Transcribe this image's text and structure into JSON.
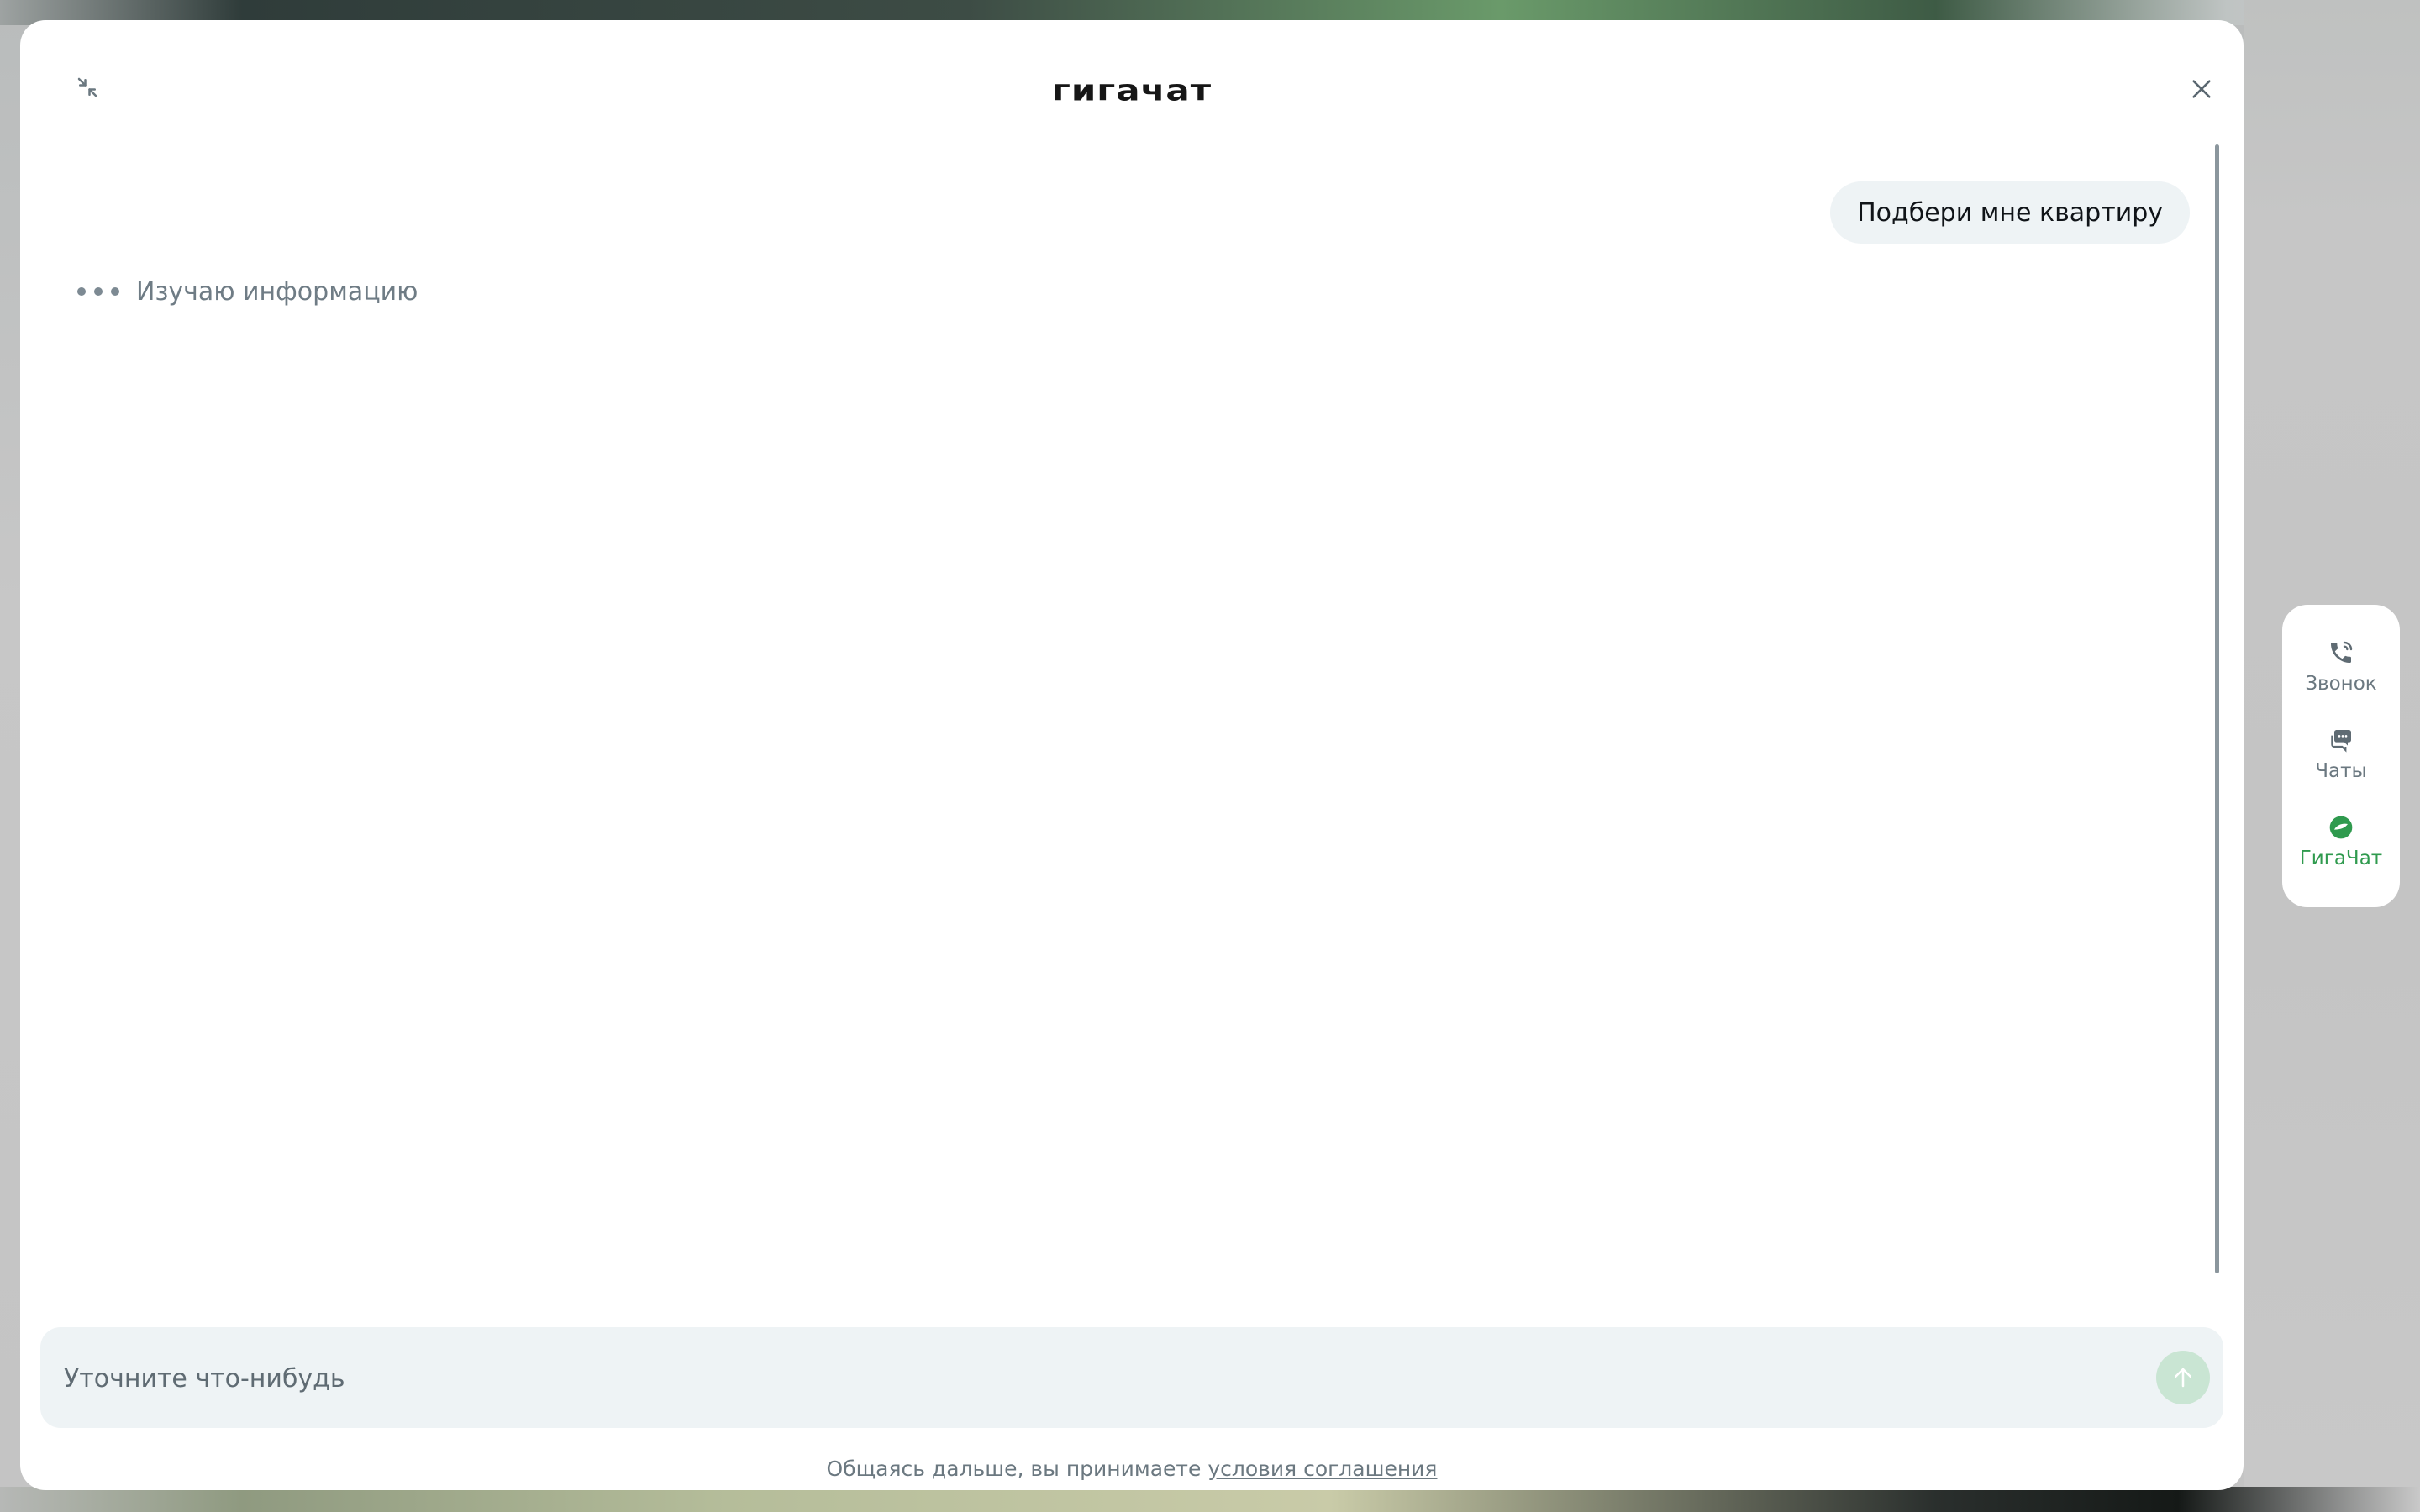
{
  "header": {
    "logo_text": "ГИГАЧАТ"
  },
  "chat": {
    "user_message": "Подбери мне квартиру",
    "status_text": "Изучаю информацию"
  },
  "composer": {
    "placeholder": "Уточните что-нибудь"
  },
  "footer": {
    "text": "Общаясь дальше, вы принимаете",
    "link_text": "условия соглашения"
  },
  "side_panel": {
    "items": [
      {
        "label": "Звонок",
        "icon": "phone-icon",
        "active": false
      },
      {
        "label": "Чаты",
        "icon": "chats-icon",
        "active": false
      },
      {
        "label": "ГигаЧат",
        "icon": "gigachat-icon",
        "active": true
      }
    ]
  },
  "colors": {
    "accent_green": "#2f9a4e",
    "send_button_disabled": "#c9e5d3",
    "bubble_bg": "#eef3f5",
    "muted_text": "#6b7880"
  }
}
